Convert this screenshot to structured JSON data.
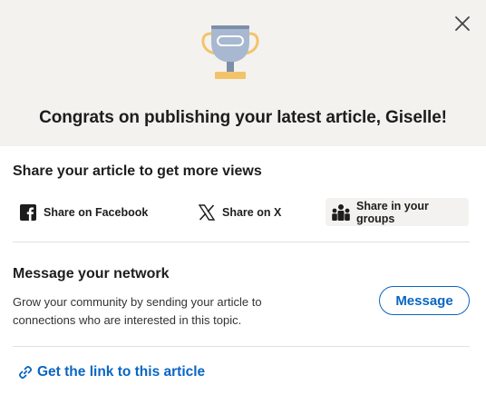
{
  "header": {
    "close_icon": "close-icon",
    "trophy_icon": "trophy-icon",
    "congrats_text": "Congrats on publishing your latest article, Giselle!"
  },
  "share": {
    "title": "Share your article to get more views",
    "buttons": [
      {
        "label": "Share on Facebook",
        "icon": "facebook-icon"
      },
      {
        "label": "Share on X",
        "icon": "x-icon"
      },
      {
        "label": "Share in your groups",
        "icon": "groups-icon"
      }
    ]
  },
  "message": {
    "title": "Message your network",
    "description": "Grow your community by sending your article to connections who are interested in this topic.",
    "button_label": "Message"
  },
  "link": {
    "label": "Get the link to this article",
    "icon": "link-icon"
  },
  "colors": {
    "accent": "#0a66c2",
    "hero_bg": "#f4f2ee",
    "trophy_cup": "#a8b8d0",
    "trophy_handles": "#f3c36a"
  }
}
